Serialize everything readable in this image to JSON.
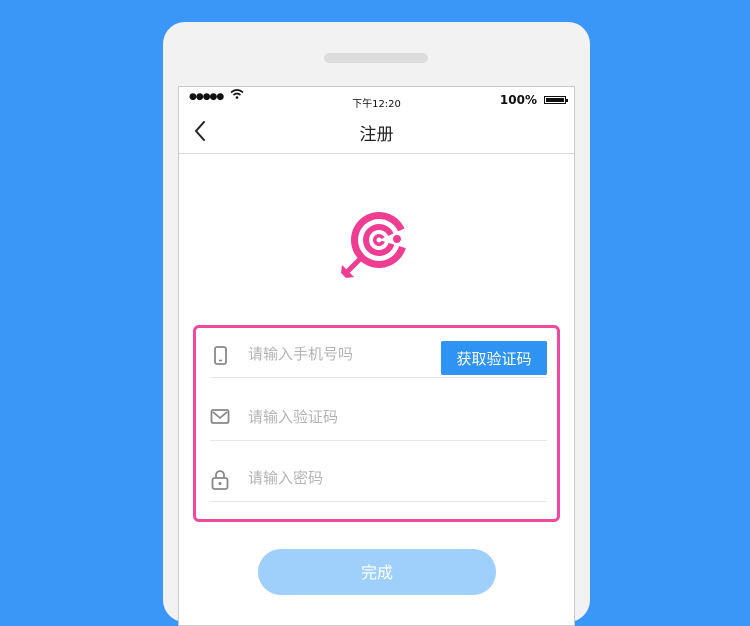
{
  "status_bar": {
    "signal": "●●●●●",
    "wifi_icon": "wifi-icon",
    "time": "下午12:20",
    "battery": "100%"
  },
  "navbar": {
    "back_icon": "chevron-left-icon",
    "title": "注册"
  },
  "logo": {
    "icon": "target-lollipop-logo",
    "color": "#ef3d93"
  },
  "form": {
    "border_color": "#ef4a9f",
    "phone": {
      "icon": "phone-icon",
      "placeholder": "请输入手机号吗",
      "value": ""
    },
    "get_code_button": "获取验证码",
    "code": {
      "icon": "envelope-icon",
      "placeholder": "请输入验证码",
      "value": ""
    },
    "password": {
      "icon": "lock-icon",
      "placeholder": "请输入密码",
      "value": ""
    }
  },
  "done_button": "完成",
  "colors": {
    "background": "#3a96f7",
    "primary": "#2f93f4",
    "done_disabled": "#9fd0fb"
  }
}
